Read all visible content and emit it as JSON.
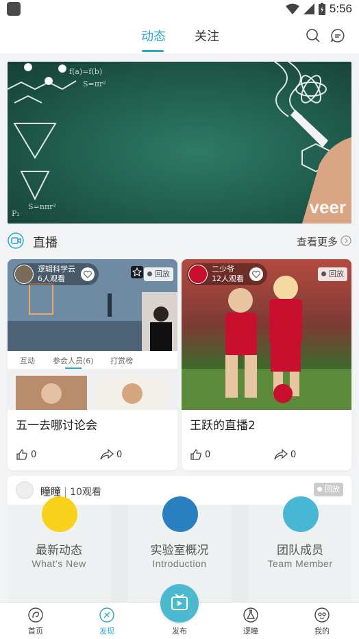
{
  "status_bar": {
    "time": "5:56"
  },
  "top_tabs": [
    {
      "label": "动态",
      "active": true
    },
    {
      "label": "关注",
      "active": false
    }
  ],
  "banner": {
    "watermark": "veer",
    "watermark_sub": "veer.com"
  },
  "live_section": {
    "title": "直播",
    "more": "查看更多"
  },
  "live_cards": [
    {
      "host": "逻辑科学云",
      "viewers": "6人观看",
      "replay": "回放",
      "inner_tabs": [
        "互动",
        "参会人员(6)",
        "打赏榜"
      ],
      "title": "五一去哪讨论会",
      "likes": "0",
      "shares": "0"
    },
    {
      "host": "二少爷",
      "viewers": "12人观看",
      "replay": "回放",
      "title": "王跃的直播2",
      "likes": "0",
      "shares": "0"
    }
  ],
  "feed": {
    "name": "瞳瞳",
    "watch": "10观看",
    "replay": "回放",
    "tiles": [
      {
        "title": "最新动态",
        "subtitle": "What's New",
        "color": "#f6d21a"
      },
      {
        "title": "实验室概况",
        "subtitle": "Introduction",
        "color": "#2a7fc0"
      },
      {
        "title": "团队成员",
        "subtitle": "Team Member",
        "color": "#47b7d4"
      }
    ]
  },
  "bottom_nav": [
    {
      "label": "首页",
      "active": false,
      "icon": "home-icon"
    },
    {
      "label": "发现",
      "active": true,
      "icon": "discover-icon"
    },
    {
      "label": "发布",
      "active": false,
      "icon": "publish-icon"
    },
    {
      "label": "逻瞳",
      "active": false,
      "icon": "flask-icon"
    },
    {
      "label": "我的",
      "active": false,
      "icon": "profile-icon"
    }
  ],
  "colors": {
    "accent": "#2aa9c9",
    "background": "#f2f3f5"
  }
}
